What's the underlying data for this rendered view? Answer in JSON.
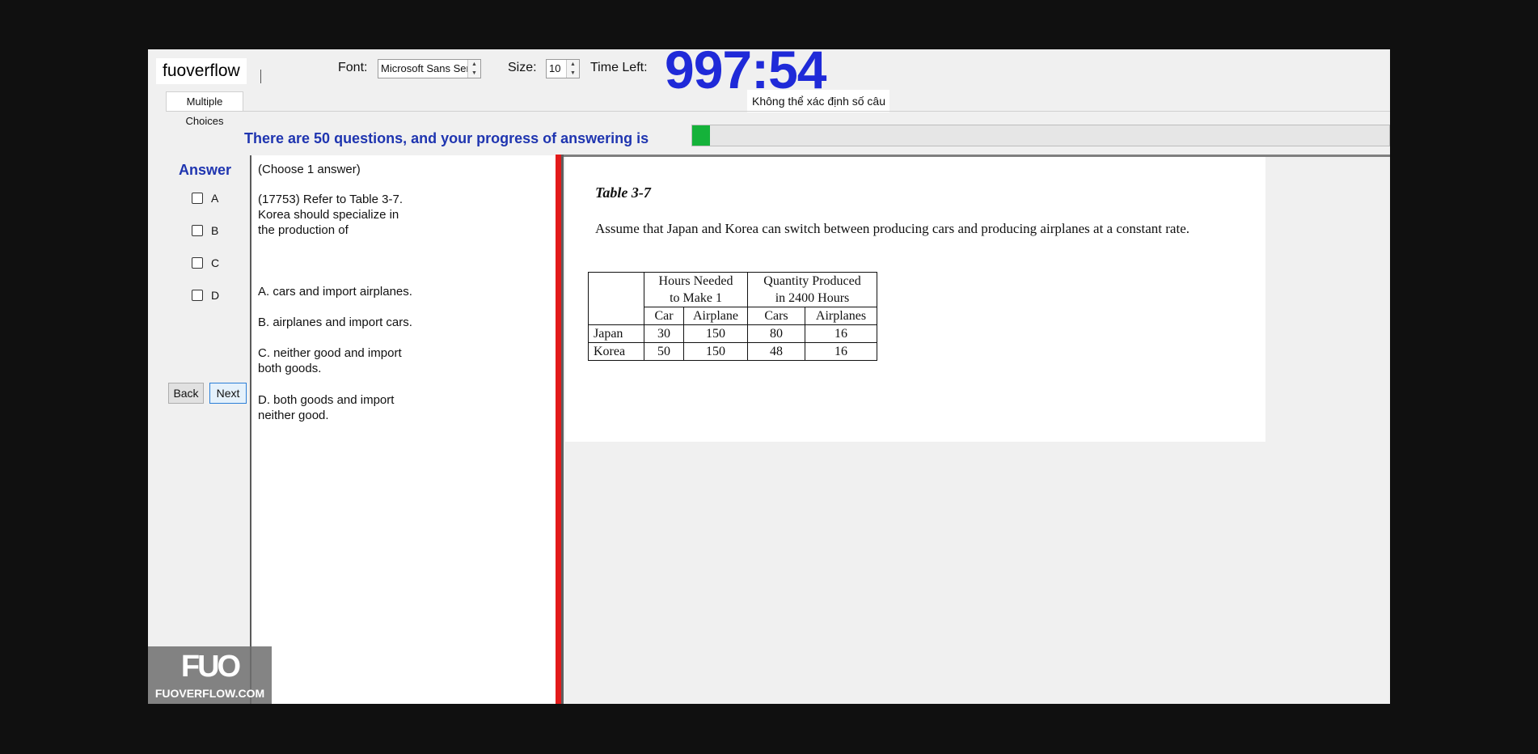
{
  "brand": {
    "text": "fuoverflow"
  },
  "toolbar": {
    "font_label": "Font:",
    "font_value": "Microsoft Sans Serif",
    "size_label": "Size:",
    "size_value": "10",
    "time_left_label": "Time Left:",
    "timer": "997:54"
  },
  "status_chip": "Không thể xác định số câu",
  "tabs": [
    {
      "label": "Multiple Choices"
    }
  ],
  "progress": {
    "text": "There are 50 questions, and your progress of answering is",
    "fraction": 0.025,
    "fill_color": "#15b23a"
  },
  "answer": {
    "title": "Answer",
    "options": [
      "A",
      "B",
      "C",
      "D"
    ],
    "back_label": "Back",
    "next_label": "Next"
  },
  "question": {
    "instruction": "(Choose 1 answer)",
    "stem_lines": [
      "(17753)  Refer to Table 3-7.",
      "Korea should specialize in",
      "the production of"
    ],
    "choices": [
      {
        "lines": [
          "A.  cars and import airplanes."
        ]
      },
      {
        "lines": [
          "B.  airplanes and import cars."
        ]
      },
      {
        "lines": [
          "C.  neither good and import",
          "both goods."
        ]
      },
      {
        "lines": [
          "D.  both goods and import",
          "neither good."
        ]
      }
    ]
  },
  "document": {
    "title": "Table 3-7",
    "body": "Assume that Japan and Korea can switch between producing cars and producing airplanes at a constant rate.",
    "table": {
      "group_headers": [
        {
          "line1": "Hours Needed",
          "line2": "to Make 1"
        },
        {
          "line1": "Quantity Produced",
          "line2": "in 2400 Hours"
        }
      ],
      "columns": [
        "Car",
        "Airplane",
        "Cars",
        "Airplanes"
      ],
      "rows": [
        {
          "name": "Japan",
          "values": [
            "30",
            "150",
            "80",
            "16"
          ]
        },
        {
          "name": "Korea",
          "values": [
            "50",
            "150",
            "48",
            "16"
          ]
        }
      ]
    }
  },
  "watermark": {
    "big": "FUO",
    "small": "FUOVERFLOW.COM"
  },
  "colors": {
    "accent_blue": "#1f35b0",
    "timer_blue": "#1f2ad8",
    "splitter_red": "#e31a1a"
  }
}
